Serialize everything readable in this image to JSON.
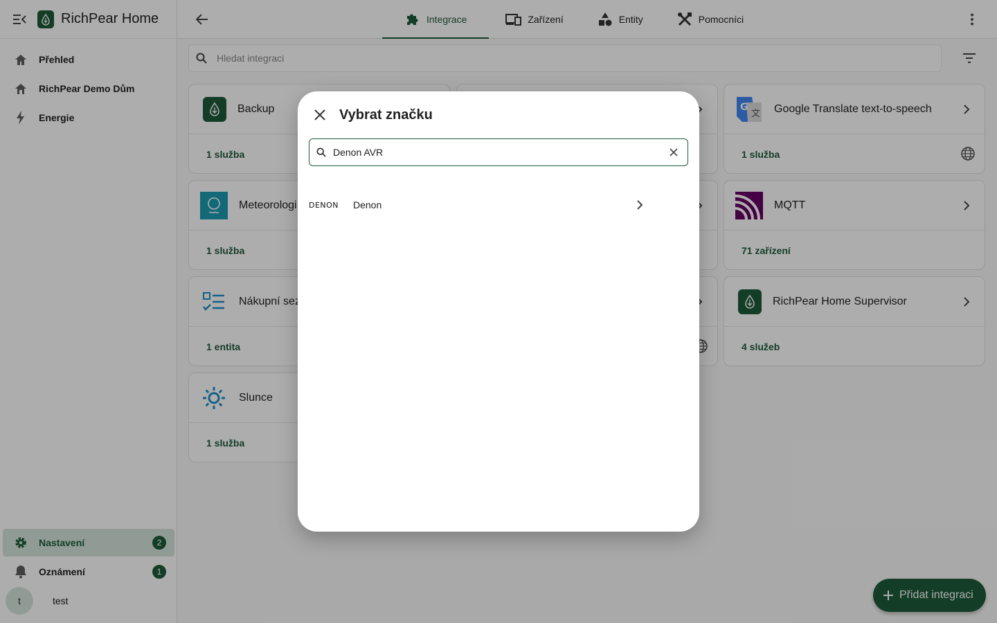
{
  "app": {
    "title": "RichPear Home"
  },
  "sidebar": {
    "items": [
      {
        "label": "Přehled",
        "icon": "home-icon"
      },
      {
        "label": "RichPear Demo Dům",
        "icon": "house-icon"
      },
      {
        "label": "Energie",
        "icon": "lightning-icon"
      }
    ],
    "bottom": [
      {
        "label": "Nastavení",
        "icon": "gear-icon",
        "badge": "2"
      },
      {
        "label": "Oznámení",
        "icon": "bell-icon",
        "badge": "1"
      }
    ],
    "user": {
      "initial": "t",
      "name": "test"
    }
  },
  "tabs": [
    {
      "label": "Integrace",
      "icon": "puzzle-icon",
      "active": true
    },
    {
      "label": "Zařízení",
      "icon": "devices-icon"
    },
    {
      "label": "Entity",
      "icon": "shapes-icon"
    },
    {
      "label": "Pomocníci",
      "icon": "tools-icon"
    }
  ],
  "search": {
    "placeholder": "Hledat integraci"
  },
  "cards": [
    {
      "name": "Backup",
      "link": "1 služba"
    },
    {
      "name": "Google Translate text-to-speech",
      "link": "1 služba"
    },
    {
      "name": "Meteorologi",
      "link": "1 služba"
    },
    {
      "name": "MQTT",
      "link": "71 zařízení"
    },
    {
      "name": "Nákupní sez",
      "link": "1 entita"
    },
    {
      "name": "RichPear Home Supervisor",
      "link": "4 služeb"
    },
    {
      "name": "Slunce",
      "link": "1 služba"
    }
  ],
  "fab": {
    "label": "Přidat integraci"
  },
  "dialog": {
    "title": "Vybrat značku",
    "search_value": "Denon AVR",
    "results": [
      {
        "logo": "DENON",
        "name": "Denon"
      }
    ]
  },
  "colors": {
    "primary": "#1e5b3a",
    "active_bg": "#d6e5dc"
  }
}
